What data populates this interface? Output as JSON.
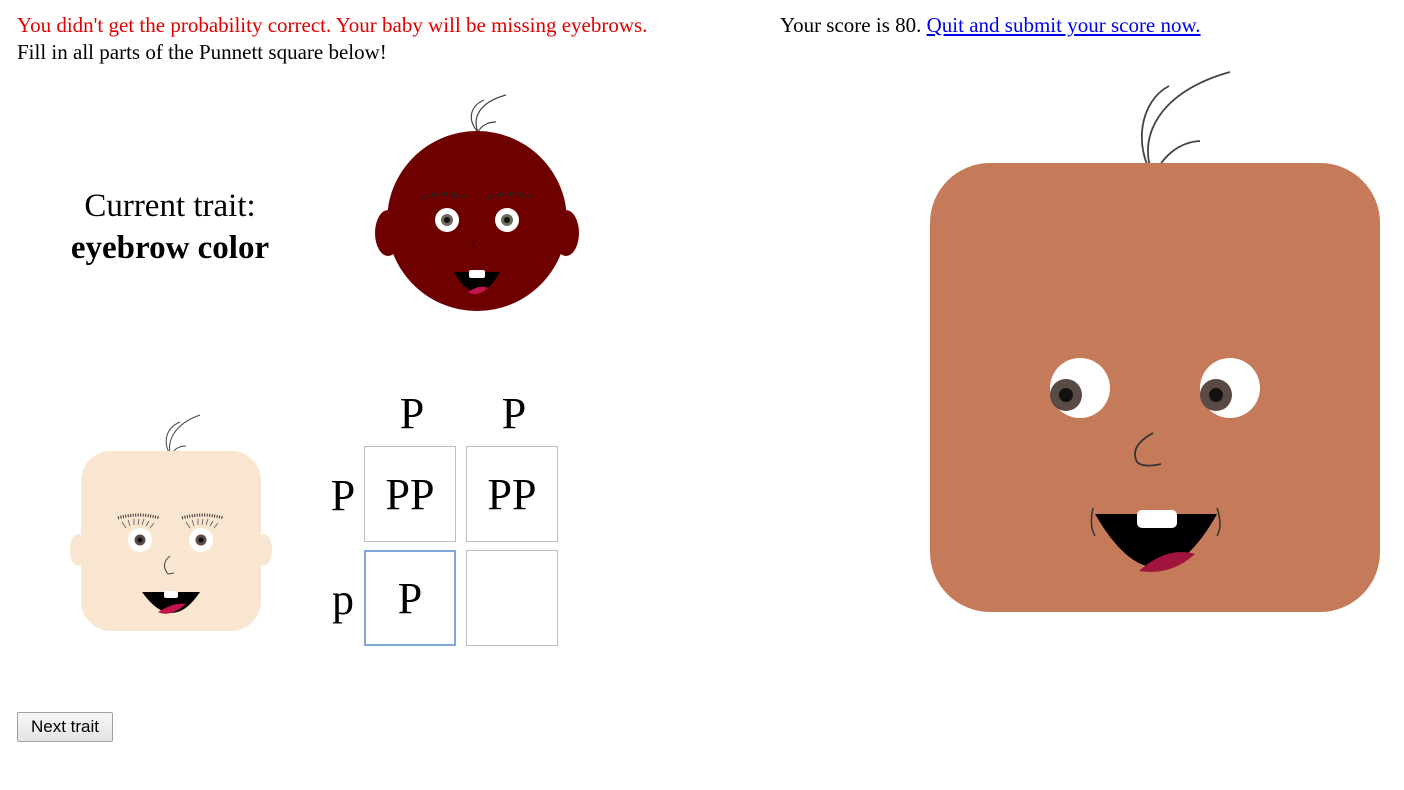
{
  "feedback": {
    "error": "You didn't get the probability correct. Your baby will be missing eyebrows.",
    "instruction": "Fill in all parts of the Punnett square below!"
  },
  "score": {
    "text": "Your score is 80.",
    "link": "Quit and submit your score now."
  },
  "trait": {
    "label": "Current trait:",
    "name": "eyebrow color"
  },
  "punnett": {
    "column_alleles": [
      "P",
      "P"
    ],
    "row_alleles": [
      "P",
      "p"
    ],
    "cells": [
      [
        "PP",
        "PP"
      ],
      [
        "P",
        ""
      ]
    ]
  },
  "buttons": {
    "next": "Next trait"
  },
  "colors": {
    "error_text": "#e00000",
    "link": "#0000ee",
    "parent_top_skin": "#6e0000",
    "parent_left_skin": "#f9e6d0",
    "baby_skin": "#c57b5a"
  }
}
